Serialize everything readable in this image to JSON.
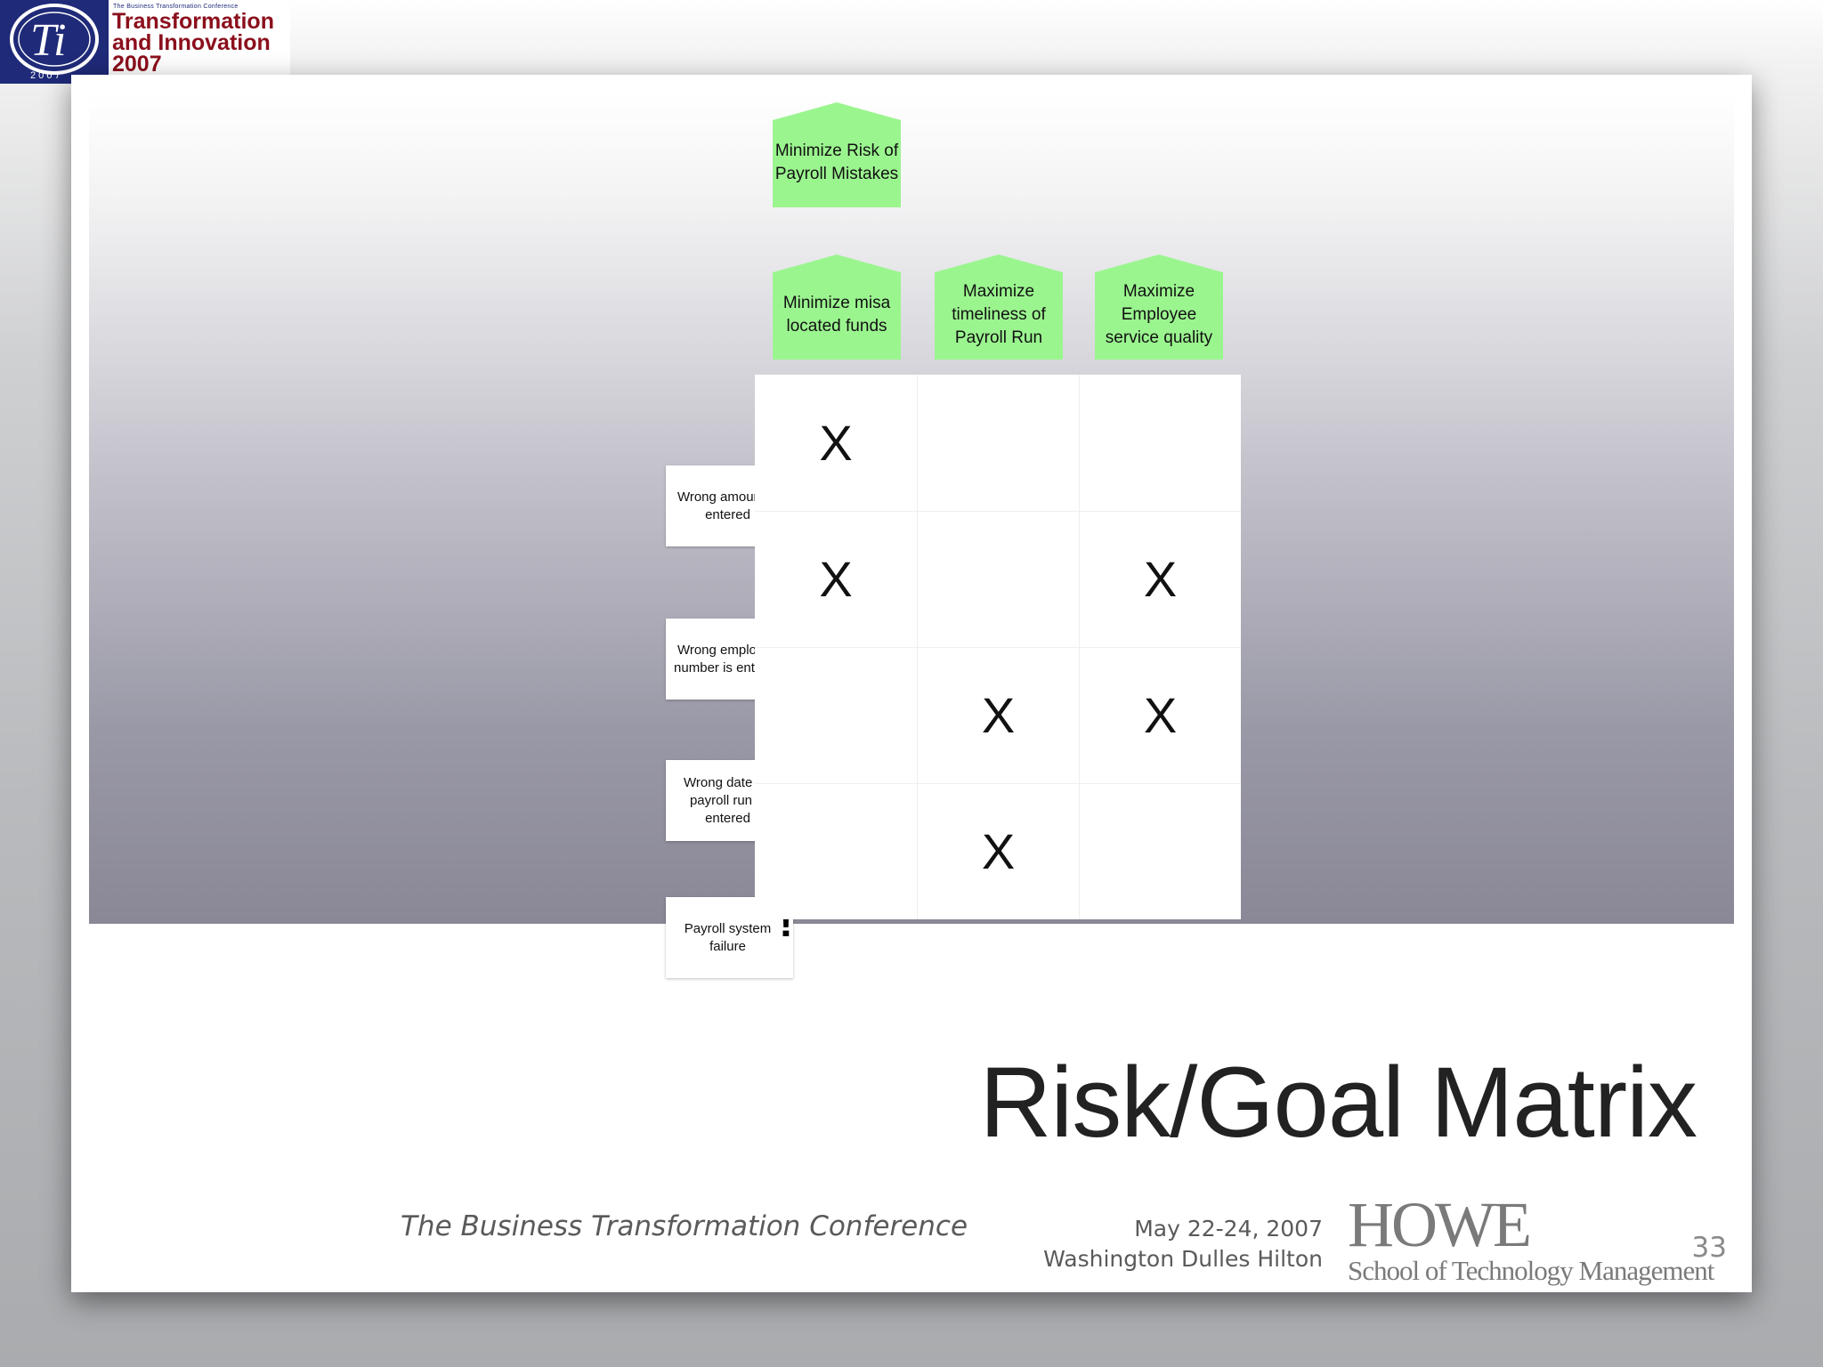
{
  "logo": {
    "emblem": "Ti",
    "emblem_year": "2 0 0 7",
    "small_text": "The Business Transformation Conference",
    "line1": "Transformation",
    "line2": "and Innovation",
    "line3": "2007"
  },
  "goals": {
    "top": "Minimize Risk of Payroll Mistakes",
    "sub": [
      "Minimize misa located funds",
      "Maximize timeliness of Payroll Run",
      "Maximize Employee service quality"
    ]
  },
  "risks": [
    "Wrong amount is entered",
    "Wrong employee number is entered",
    "Wrong date for payroll run is entered",
    "Payroll system failure"
  ],
  "risk_icon": "!",
  "matrix": {
    "mark": "X",
    "rows": [
      [
        "X",
        "",
        ""
      ],
      [
        "X",
        "",
        "X"
      ],
      [
        "",
        "X",
        "X"
      ],
      [
        "",
        "X",
        ""
      ]
    ]
  },
  "title": "Risk/Goal Matrix",
  "footer": {
    "conference": "The Business Transformation Conference",
    "date": "May 22-24, 2007",
    "venue": "Washington Dulles Hilton",
    "howe": "HOWE",
    "school": "School of Technology Management",
    "page": "33"
  }
}
